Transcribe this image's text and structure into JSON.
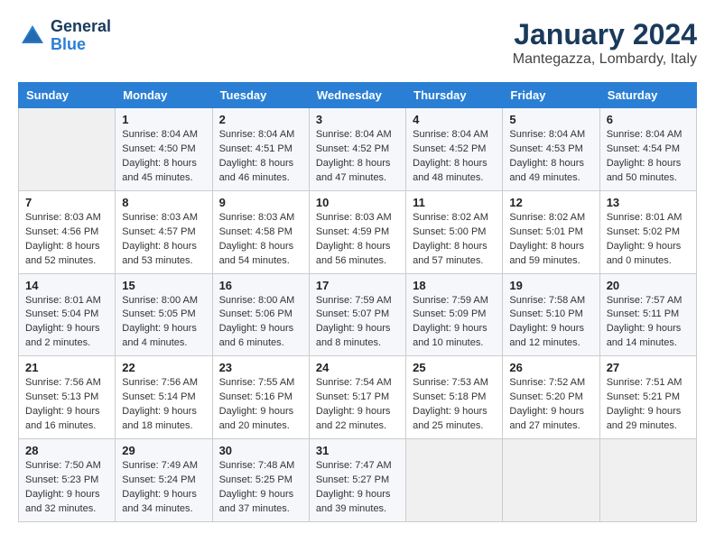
{
  "header": {
    "logo_line1": "General",
    "logo_line2": "Blue",
    "main_title": "January 2024",
    "subtitle": "Mantegazza, Lombardy, Italy"
  },
  "columns": [
    "Sunday",
    "Monday",
    "Tuesday",
    "Wednesday",
    "Thursday",
    "Friday",
    "Saturday"
  ],
  "weeks": [
    [
      {
        "day": "",
        "info": ""
      },
      {
        "day": "1",
        "info": "Sunrise: 8:04 AM\nSunset: 4:50 PM\nDaylight: 8 hours\nand 45 minutes."
      },
      {
        "day": "2",
        "info": "Sunrise: 8:04 AM\nSunset: 4:51 PM\nDaylight: 8 hours\nand 46 minutes."
      },
      {
        "day": "3",
        "info": "Sunrise: 8:04 AM\nSunset: 4:52 PM\nDaylight: 8 hours\nand 47 minutes."
      },
      {
        "day": "4",
        "info": "Sunrise: 8:04 AM\nSunset: 4:52 PM\nDaylight: 8 hours\nand 48 minutes."
      },
      {
        "day": "5",
        "info": "Sunrise: 8:04 AM\nSunset: 4:53 PM\nDaylight: 8 hours\nand 49 minutes."
      },
      {
        "day": "6",
        "info": "Sunrise: 8:04 AM\nSunset: 4:54 PM\nDaylight: 8 hours\nand 50 minutes."
      }
    ],
    [
      {
        "day": "7",
        "info": "Sunrise: 8:03 AM\nSunset: 4:56 PM\nDaylight: 8 hours\nand 52 minutes."
      },
      {
        "day": "8",
        "info": "Sunrise: 8:03 AM\nSunset: 4:57 PM\nDaylight: 8 hours\nand 53 minutes."
      },
      {
        "day": "9",
        "info": "Sunrise: 8:03 AM\nSunset: 4:58 PM\nDaylight: 8 hours\nand 54 minutes."
      },
      {
        "day": "10",
        "info": "Sunrise: 8:03 AM\nSunset: 4:59 PM\nDaylight: 8 hours\nand 56 minutes."
      },
      {
        "day": "11",
        "info": "Sunrise: 8:02 AM\nSunset: 5:00 PM\nDaylight: 8 hours\nand 57 minutes."
      },
      {
        "day": "12",
        "info": "Sunrise: 8:02 AM\nSunset: 5:01 PM\nDaylight: 8 hours\nand 59 minutes."
      },
      {
        "day": "13",
        "info": "Sunrise: 8:01 AM\nSunset: 5:02 PM\nDaylight: 9 hours\nand 0 minutes."
      }
    ],
    [
      {
        "day": "14",
        "info": "Sunrise: 8:01 AM\nSunset: 5:04 PM\nDaylight: 9 hours\nand 2 minutes."
      },
      {
        "day": "15",
        "info": "Sunrise: 8:00 AM\nSunset: 5:05 PM\nDaylight: 9 hours\nand 4 minutes."
      },
      {
        "day": "16",
        "info": "Sunrise: 8:00 AM\nSunset: 5:06 PM\nDaylight: 9 hours\nand 6 minutes."
      },
      {
        "day": "17",
        "info": "Sunrise: 7:59 AM\nSunset: 5:07 PM\nDaylight: 9 hours\nand 8 minutes."
      },
      {
        "day": "18",
        "info": "Sunrise: 7:59 AM\nSunset: 5:09 PM\nDaylight: 9 hours\nand 10 minutes."
      },
      {
        "day": "19",
        "info": "Sunrise: 7:58 AM\nSunset: 5:10 PM\nDaylight: 9 hours\nand 12 minutes."
      },
      {
        "day": "20",
        "info": "Sunrise: 7:57 AM\nSunset: 5:11 PM\nDaylight: 9 hours\nand 14 minutes."
      }
    ],
    [
      {
        "day": "21",
        "info": "Sunrise: 7:56 AM\nSunset: 5:13 PM\nDaylight: 9 hours\nand 16 minutes."
      },
      {
        "day": "22",
        "info": "Sunrise: 7:56 AM\nSunset: 5:14 PM\nDaylight: 9 hours\nand 18 minutes."
      },
      {
        "day": "23",
        "info": "Sunrise: 7:55 AM\nSunset: 5:16 PM\nDaylight: 9 hours\nand 20 minutes."
      },
      {
        "day": "24",
        "info": "Sunrise: 7:54 AM\nSunset: 5:17 PM\nDaylight: 9 hours\nand 22 minutes."
      },
      {
        "day": "25",
        "info": "Sunrise: 7:53 AM\nSunset: 5:18 PM\nDaylight: 9 hours\nand 25 minutes."
      },
      {
        "day": "26",
        "info": "Sunrise: 7:52 AM\nSunset: 5:20 PM\nDaylight: 9 hours\nand 27 minutes."
      },
      {
        "day": "27",
        "info": "Sunrise: 7:51 AM\nSunset: 5:21 PM\nDaylight: 9 hours\nand 29 minutes."
      }
    ],
    [
      {
        "day": "28",
        "info": "Sunrise: 7:50 AM\nSunset: 5:23 PM\nDaylight: 9 hours\nand 32 minutes."
      },
      {
        "day": "29",
        "info": "Sunrise: 7:49 AM\nSunset: 5:24 PM\nDaylight: 9 hours\nand 34 minutes."
      },
      {
        "day": "30",
        "info": "Sunrise: 7:48 AM\nSunset: 5:25 PM\nDaylight: 9 hours\nand 37 minutes."
      },
      {
        "day": "31",
        "info": "Sunrise: 7:47 AM\nSunset: 5:27 PM\nDaylight: 9 hours\nand 39 minutes."
      },
      {
        "day": "",
        "info": ""
      },
      {
        "day": "",
        "info": ""
      },
      {
        "day": "",
        "info": ""
      }
    ]
  ]
}
